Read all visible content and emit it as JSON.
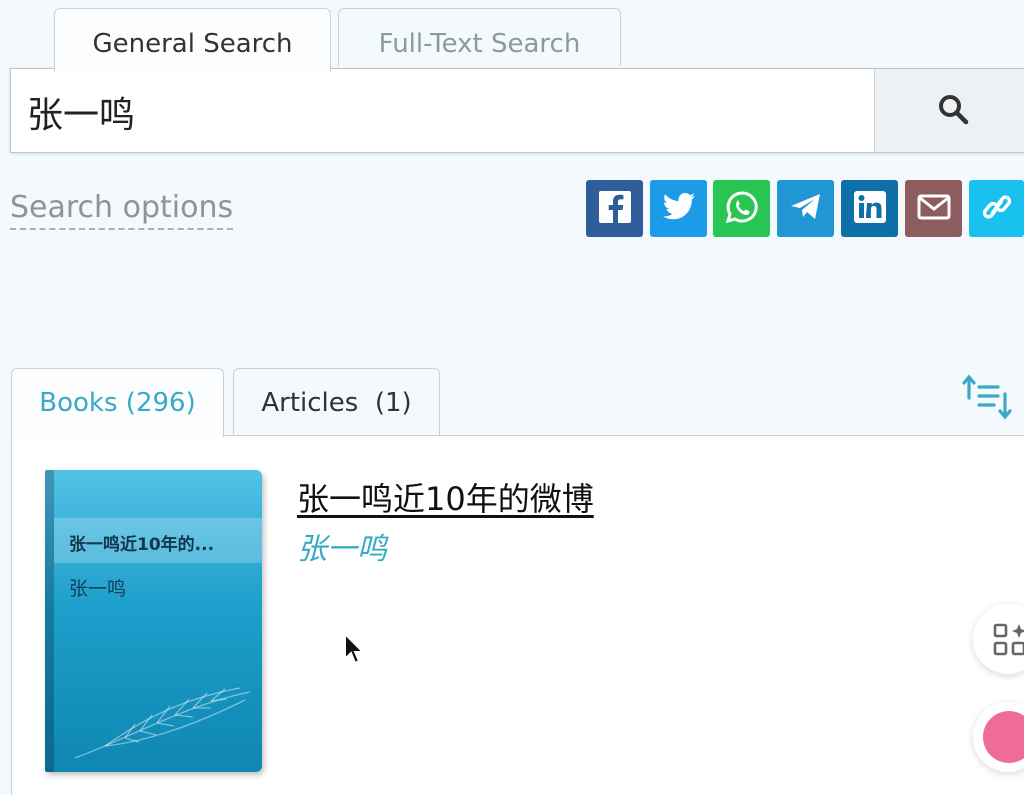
{
  "search_tabs": [
    {
      "label": "General Search",
      "active": true
    },
    {
      "label": "Full-Text Search",
      "active": false
    }
  ],
  "search": {
    "value": "张一鸣",
    "button_icon": "search-icon"
  },
  "search_options_label": "Search options",
  "share_buttons": [
    {
      "name": "facebook-icon",
      "color": "#2f5d9a"
    },
    {
      "name": "twitter-icon",
      "color": "#1c9be8"
    },
    {
      "name": "whatsapp-icon",
      "color": "#29c653"
    },
    {
      "name": "telegram-icon",
      "color": "#2196d4"
    },
    {
      "name": "linkedin-icon",
      "color": "#0f6fa8"
    },
    {
      "name": "email-icon",
      "color": "#8c5c5f"
    },
    {
      "name": "link-icon",
      "color": "#19c1ee"
    }
  ],
  "result_tabs": [
    {
      "label": "Books (296)",
      "active": true
    },
    {
      "label": "Articles  (1)",
      "active": false
    }
  ],
  "sort_icon": "sort-icon",
  "result": {
    "cover_title": "张一鸣近10年的...",
    "cover_author": "张一鸣",
    "title": "张一鸣近10年的微博",
    "author": "张一鸣"
  },
  "colors": {
    "accent": "#3aa9c6",
    "background": "#f3f9fc"
  }
}
